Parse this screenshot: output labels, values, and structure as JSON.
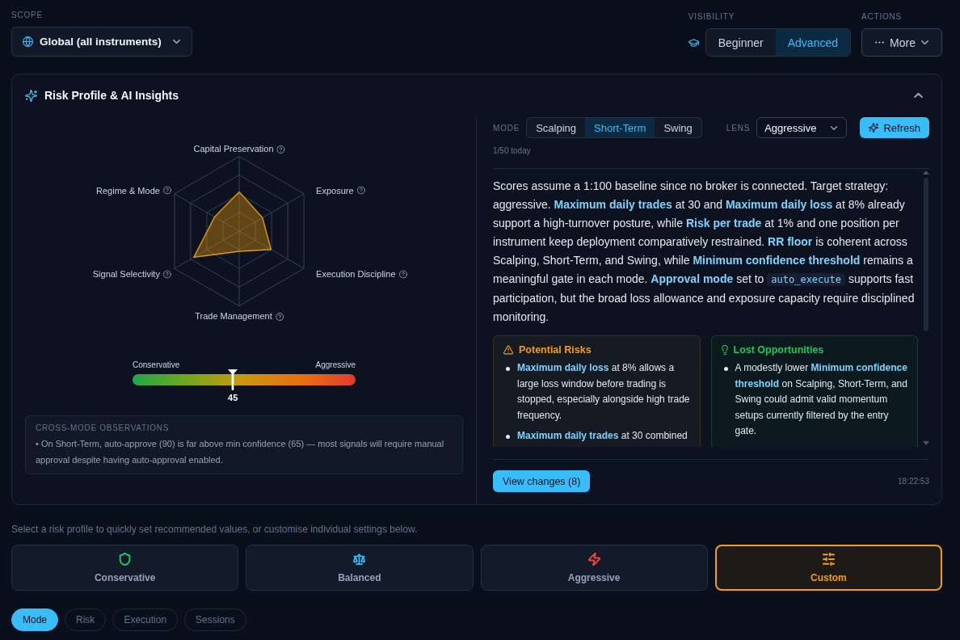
{
  "scope": {
    "label": "SCOPE",
    "value": "Global (all instruments)"
  },
  "visibility": {
    "label": "VISIBILITY",
    "options": [
      {
        "label": "Beginner",
        "selected": false
      },
      {
        "label": "Advanced",
        "selected": true
      }
    ]
  },
  "actions": {
    "label": "ACTIONS",
    "button": "More"
  },
  "insights": {
    "title": "Risk Profile & AI Insights",
    "expanded": true,
    "radar": {
      "axes": [
        {
          "label": "Capital Preservation"
        },
        {
          "label": "Regime & Mode"
        },
        {
          "label": "Exposure"
        },
        {
          "label": "Signal Selectivity"
        },
        {
          "label": "Execution Discipline"
        },
        {
          "label": "Trade Management"
        }
      ]
    },
    "risk_meter": {
      "min_label": "Conservative",
      "max_label": "Aggressive",
      "level": 0.45,
      "reading": "45"
    },
    "observations": {
      "title": "CROSS-MODE OBSERVATIONS",
      "items": [
        "• On Short-Term, auto-approve (90) is far above min confidence (65) — most signals will require manual approval despite having auto-approval enabled."
      ]
    },
    "mode": {
      "label": "MODE",
      "options": [
        {
          "label": "Scalping",
          "selected": false
        },
        {
          "label": "Short-Term",
          "selected": true
        },
        {
          "label": "Swing",
          "selected": false
        }
      ]
    },
    "lens": {
      "label": "LENS",
      "value": "Aggressive"
    },
    "refresh_button": "Refresh",
    "usage": "1/50 today",
    "summary": [
      {
        "kind": "text",
        "text": "Scores assume a 1:100 baseline since no broker is connected. Target strategy: aggressive. **Maximum daily trades** at 30 and **Maximum daily loss** at 8% already support a high-turnover posture, while **Risk per trade** at 1% and one position per instrument keep deployment comparatively restrained. **RR floor** is coherent across Scalping, Short-Term, and Swing, while **Minimum confidence threshold** remains a meaningful gate in each mode. **Approval mode** set to "
      },
      {
        "kind": "code",
        "text": "auto_execute"
      },
      {
        "kind": "text",
        "text": " supports fast participation, but the broad loss allowance and exposure capacity require disciplined monitoring."
      }
    ],
    "findings": [
      {
        "kind": "risk",
        "title": "Potential Risks",
        "items": [
          "**Maximum daily loss** at 8% allows a large loss window before trading is stopped, especially alongside high trade frequency.",
          "**Maximum daily trades** at 30 combined"
        ]
      },
      {
        "kind": "opportunity",
        "title": "Lost Opportunities",
        "items": [
          "A modestly lower **Minimum confidence threshold** on Scalping, Short-Term, and Swing could admit valid momentum setups currently filtered by the entry gate."
        ]
      }
    ],
    "view_changes_button": "View changes (8)",
    "timestamp": "18:22:53"
  },
  "profiles": {
    "hint": "Select a risk profile to quickly set recommended values, or customise individual settings below.",
    "options": [
      {
        "kind": "conservative",
        "label": "Conservative",
        "color": "#22c55e",
        "selected": false
      },
      {
        "kind": "balanced",
        "label": "Balanced",
        "color": "#38bdf8",
        "selected": false
      },
      {
        "kind": "aggressive",
        "label": "Aggressive",
        "color": "#ef4444",
        "selected": false
      },
      {
        "kind": "custom",
        "label": "Custom",
        "color": "#f59e0b",
        "selected": true
      }
    ]
  },
  "tabs": [
    {
      "label": "Mode",
      "selected": true
    },
    {
      "label": "Risk",
      "selected": false
    },
    {
      "label": "Execution",
      "selected": false
    },
    {
      "label": "Sessions",
      "selected": false
    }
  ]
}
